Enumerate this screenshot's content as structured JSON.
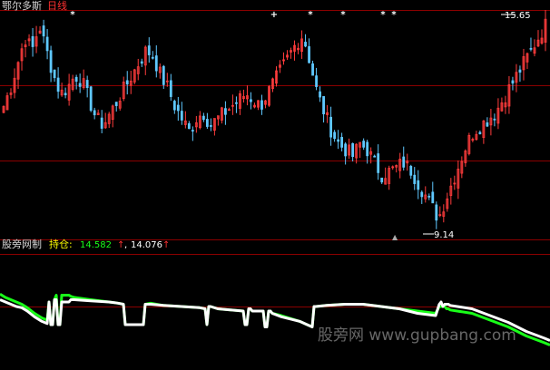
{
  "price_panel": {
    "title": "鄂尔多斯",
    "period": "日线",
    "high_label": "15.65",
    "low_label": "9.14",
    "marker_glyphs": [
      "*",
      "+",
      "*",
      "*",
      "*",
      "*"
    ]
  },
  "indicator_panel": {
    "name": "股旁网制",
    "hold_label": "持仓:",
    "value_1": "14.582",
    "value_2": "14.076",
    "arrow": "↑"
  },
  "watermark": "股旁网 www.gupbang.com",
  "colors": {
    "background": "#000000",
    "up_candle": "#ff3c3c",
    "down_candle": "#5fc8ff",
    "gridline": "#8b0000",
    "upper_line": "#19ff19",
    "lower_line": "#ffffff",
    "title_text": "#d8d8d8",
    "period_text": "#ff3030",
    "hold_text": "#ffff00",
    "value1_text": "#19ff19",
    "value2_text": "#ffffff"
  },
  "chart_data": [
    {
      "type": "candlestick",
      "title": "鄂尔多斯",
      "xlabel": "",
      "ylabel": "",
      "ylim": [
        8.9,
        16.0
      ],
      "grid": true,
      "annotations": [
        {
          "text": "15.65",
          "value": 15.65
        },
        {
          "text": "9.14",
          "value": 9.14
        }
      ],
      "close_path": [
        13.0,
        13.6,
        14.4,
        15.2,
        14.8,
        15.6,
        14.8,
        14.0,
        13.4,
        13.6,
        14.0,
        13.8,
        13.2,
        12.6,
        12.4,
        12.8,
        13.2,
        13.6,
        14.0,
        14.4,
        14.8,
        14.6,
        14.0,
        13.6,
        13.0,
        12.6,
        12.2,
        12.6,
        12.8,
        12.4,
        12.6,
        12.8,
        13.0,
        13.2,
        13.4,
        13.2,
        13.0,
        13.4,
        13.8,
        14.2,
        14.6,
        15.0,
        15.3,
        14.4,
        13.4,
        12.8,
        12.2,
        11.8,
        11.6,
        11.4,
        11.8,
        11.6,
        11.2,
        10.8,
        10.9,
        11.0,
        11.2,
        11.0,
        10.6,
        10.2,
        9.8,
        9.4,
        10.0,
        10.6,
        11.2,
        11.8,
        12.2,
        12.4,
        12.6,
        12.8,
        13.2,
        13.6,
        14.0,
        14.4,
        14.8,
        15.2,
        15.6
      ]
    },
    {
      "type": "line",
      "title": "股旁网制",
      "xlabel": "",
      "ylabel": "",
      "grid": true,
      "series": [
        {
          "name": "",
          "x": [
            0,
            6,
            12,
            18,
            24,
            30,
            38,
            46,
            52,
            54,
            56,
            58,
            60,
            62,
            64,
            66,
            68,
            70,
            72,
            74,
            76,
            78,
            82,
            100,
            120,
            130,
            136,
            138,
            140,
            156,
            158,
            160,
            166,
            180,
            200,
            220,
            226,
            228,
            230,
            232,
            240,
            268,
            270,
            272,
            274,
            276,
            278,
            290,
            292,
            294,
            296,
            298,
            300,
            310,
            330,
            344,
            346,
            348,
            360,
            380,
            400,
            420,
            440,
            460,
            480,
            484,
            486,
            488,
            490,
            492,
            494,
            496,
            520,
            540,
            560,
            580,
            600,
            606
          ],
          "values": [
            67,
            64,
            62,
            60,
            58,
            55,
            50,
            46,
            44,
            60,
            40,
            40,
            62,
            66,
            40,
            40,
            66,
            66,
            66,
            66,
            66,
            65,
            64,
            62,
            60,
            59,
            58,
            40,
            40,
            40,
            40,
            58,
            59,
            57,
            56,
            55,
            54,
            40,
            56,
            56,
            54,
            52,
            40,
            40,
            54,
            54,
            52,
            52,
            38,
            38,
            52,
            52,
            50,
            48,
            43,
            38,
            56,
            56,
            57,
            58,
            58,
            56,
            54,
            52,
            50,
            56,
            56,
            56,
            56,
            54,
            54,
            53,
            50,
            44,
            38,
            30,
            24,
            22
          ]
        },
        {
          "name": "",
          "x": [
            0,
            6,
            12,
            18,
            24,
            30,
            38,
            46,
            52,
            54,
            56,
            58,
            60,
            62,
            64,
            66,
            68,
            70,
            72,
            74,
            76,
            78,
            82,
            100,
            120,
            130,
            136,
            138,
            140,
            156,
            158,
            160,
            166,
            180,
            200,
            220,
            226,
            228,
            230,
            232,
            240,
            268,
            270,
            272,
            274,
            276,
            278,
            290,
            292,
            294,
            296,
            298,
            300,
            310,
            330,
            344,
            346,
            348,
            360,
            380,
            400,
            420,
            440,
            460,
            480,
            484,
            486,
            488,
            490,
            492,
            494,
            496,
            520,
            540,
            560,
            580,
            600,
            606
          ],
          "values": [
            62,
            60,
            58,
            56,
            55,
            52,
            47,
            43,
            41,
            60,
            40,
            40,
            62,
            62,
            40,
            40,
            60,
            60,
            60,
            60,
            60,
            62,
            62,
            61,
            60,
            59,
            58,
            40,
            40,
            40,
            40,
            58,
            58,
            57,
            56,
            55,
            54,
            40,
            56,
            56,
            54,
            52,
            40,
            40,
            54,
            54,
            52,
            52,
            38,
            38,
            52,
            52,
            50,
            47,
            43,
            38,
            56,
            56,
            57,
            58,
            58,
            56,
            54,
            50,
            48,
            58,
            60,
            56,
            58,
            58,
            58,
            57,
            54,
            48,
            42,
            34,
            28,
            26
          ]
        }
      ]
    }
  ]
}
